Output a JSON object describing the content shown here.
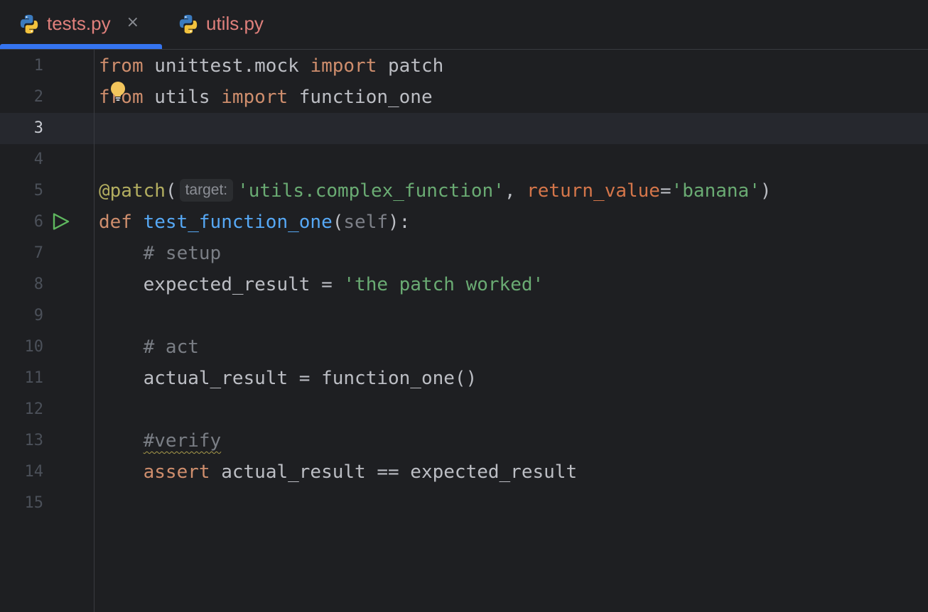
{
  "tabs": [
    {
      "label": "tests.py",
      "active": true,
      "icon": "python-icon",
      "close": "×"
    },
    {
      "label": "utils.py",
      "active": false,
      "icon": "python-icon"
    }
  ],
  "lines": [
    "1",
    "2",
    "3",
    "4",
    "5",
    "6",
    "7",
    "8",
    "9",
    "10",
    "11",
    "12",
    "13",
    "14",
    "15"
  ],
  "current_line": "3",
  "code": {
    "l1": {
      "kw1": "from",
      "mod": " unittest.mock ",
      "kw2": "import",
      "name": " patch"
    },
    "l2": {
      "kw1": "from",
      "mod": " utils ",
      "kw2": "import",
      "name": " function_one"
    },
    "l5": {
      "dec": "@patch",
      "open": "(",
      "hint": "target:",
      "str1": "'utils.complex_function'",
      "comma": ", ",
      "param": "return_value",
      "eq": "=",
      "str2": "'banana'",
      "close": ")"
    },
    "l6": {
      "kw": "def",
      "fn": "test_function_one",
      "open": "(",
      "self": "self",
      "close": "):"
    },
    "l7": {
      "cmt": "# setup"
    },
    "l8": {
      "var": "expected_result = ",
      "str": "'the patch worked'"
    },
    "l10": {
      "cmt": "# act"
    },
    "l11": {
      "text": "actual_result = function_one()"
    },
    "l13": {
      "cmt": "#verify"
    },
    "l14": {
      "kw": "assert",
      "text": " actual_result == expected_result"
    }
  },
  "colors": {
    "background": "#1e1f22",
    "accent": "#3574f0",
    "keyword": "#cf8e6d",
    "string": "#6aab73",
    "comment": "#7a7e85",
    "function": "#56a8f5",
    "decorator": "#b3ae60",
    "run_icon": "#5fb85f"
  }
}
